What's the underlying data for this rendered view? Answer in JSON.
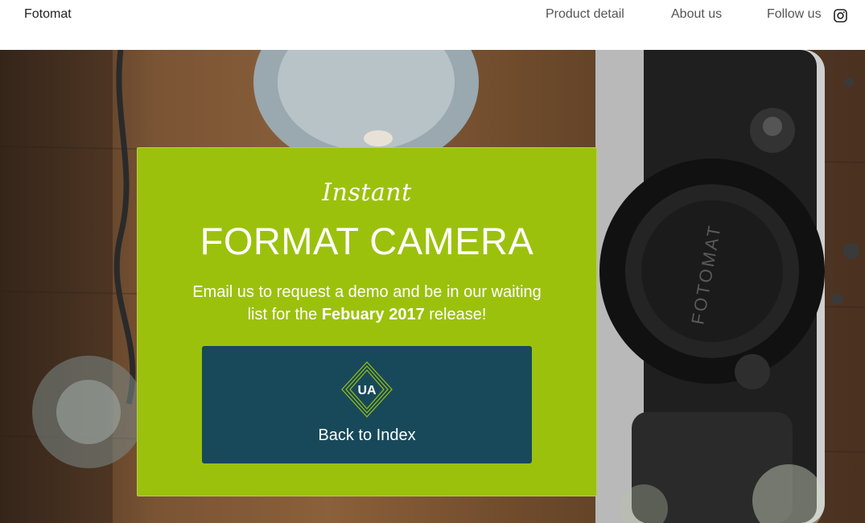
{
  "navbar": {
    "brand": "Fotomat",
    "links": [
      {
        "label": "Product detail"
      },
      {
        "label": "About us"
      },
      {
        "label": "Follow us",
        "icon": "instagram-icon"
      }
    ]
  },
  "hero": {
    "background": "photo of a vintage Fotomat camera on a wooden table",
    "camera_brand": "FOTOMAT"
  },
  "card": {
    "kicker": "Instant",
    "headline": "FORMAT CAMERA",
    "body_prefix": "Email us to request a demo and be in our waiting list for the ",
    "body_highlight": "Febuary 2017",
    "body_suffix": " release!",
    "button": {
      "logo_text": "UA",
      "label": "Back to Index"
    }
  },
  "colors": {
    "card": "#9cc10c",
    "button": "#17495a",
    "logo_stroke": "#9cc10c"
  }
}
